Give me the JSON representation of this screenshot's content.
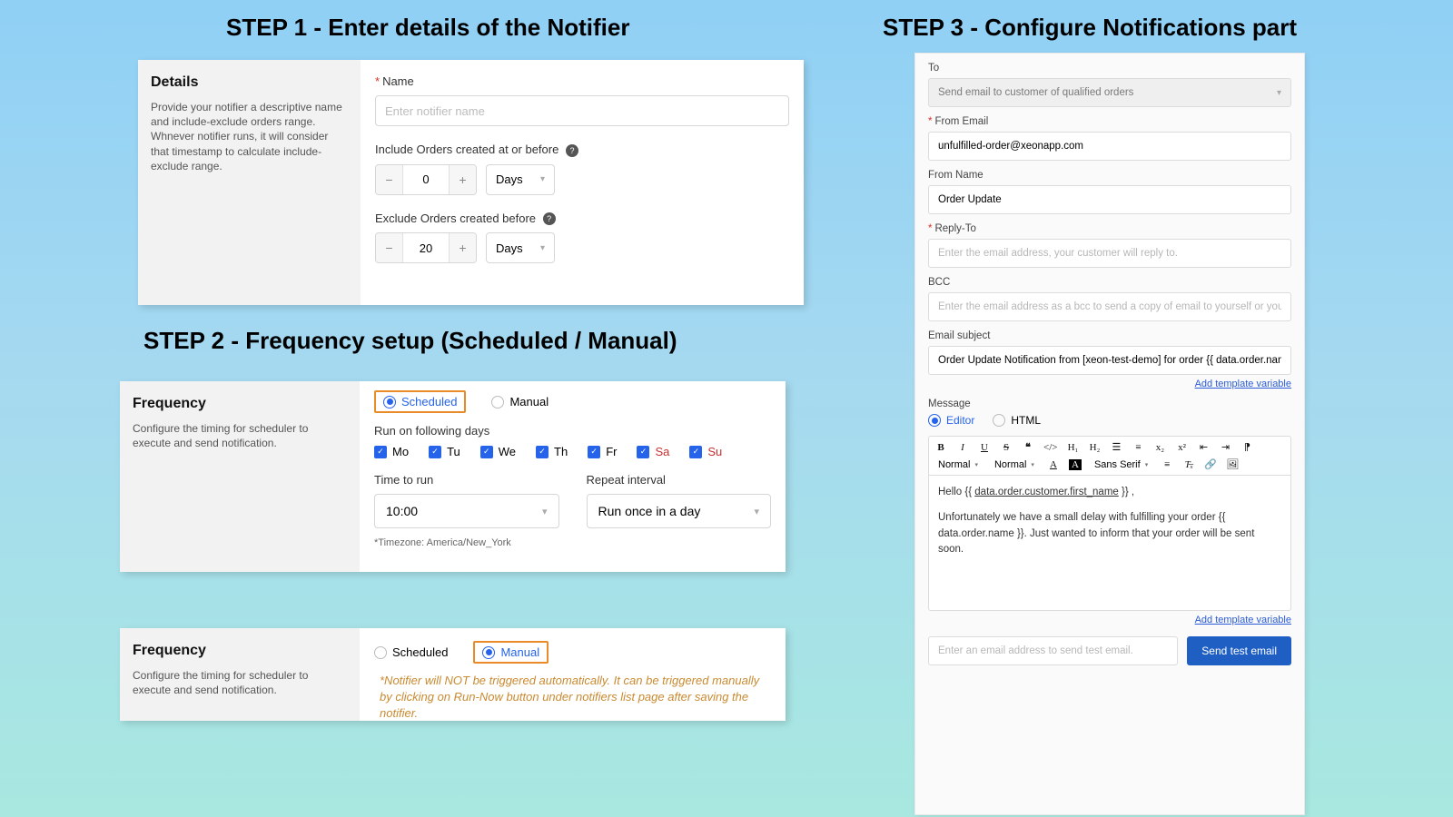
{
  "headings": {
    "step1": "STEP 1 - Enter details of the Notifier",
    "step2": "STEP 2 - Frequency setup (Scheduled / Manual)",
    "step3": "STEP 3  - Configure Notifications part"
  },
  "step1": {
    "left_title": "Details",
    "left_desc": "Provide your notifier a descriptive name and include-exclude orders range. Whnever notifier runs, it will consider that timestamp to calculate include-exclude range.",
    "name_label": "Name",
    "name_placeholder": "Enter notifier name",
    "include_label": "Include Orders created at or before",
    "include_value": "0",
    "include_unit": "Days",
    "exclude_label": "Exclude Orders created before",
    "exclude_value": "20",
    "exclude_unit": "Days"
  },
  "step2a": {
    "left_title": "Frequency",
    "left_desc": "Configure the timing for scheduler to execute and send notification.",
    "opt_scheduled": "Scheduled",
    "opt_manual": "Manual",
    "days_label": "Run on following days",
    "days": [
      "Mo",
      "Tu",
      "We",
      "Th",
      "Fr",
      "Sa",
      "Su"
    ],
    "time_label": "Time to run",
    "time_value": "10:00",
    "repeat_label": "Repeat interval",
    "repeat_value": "Run once in a day",
    "tz": "*Timezone: America/New_York"
  },
  "step2b": {
    "left_title": "Frequency",
    "left_desc": "Configure the timing for scheduler to execute and send notification.",
    "opt_scheduled": "Scheduled",
    "opt_manual": "Manual",
    "note": "*Notifier will NOT be triggered automatically. It can be triggered manually by clicking on Run-Now button under notifiers list page after saving the notifier."
  },
  "step3": {
    "to_label": "To",
    "to_value": "Send email to customer of qualified orders",
    "from_email_label": "From Email",
    "from_email_value": "unfulfilled-order@xeonapp.com",
    "from_name_label": "From Name",
    "from_name_value": "Order Update",
    "reply_label": "Reply-To",
    "reply_placeholder": "Enter the email address, your customer will reply to.",
    "bcc_label": "BCC",
    "bcc_placeholder": "Enter the email address as a bcc to send a copy of email to yourself or your team",
    "subject_label": "Email subject",
    "subject_value": "Order Update Notification from [xeon-test-demo] for order {{ data.order.name }}",
    "add_var": "Add template variable",
    "message_label": "Message",
    "opt_editor": "Editor",
    "opt_html": "HTML",
    "toolbar": {
      "normal": "Normal",
      "sans": "Sans Serif"
    },
    "body_hello_pre": "Hello {{ ",
    "body_hello_var": "data.order.customer.first_name",
    "body_hello_post": " }} ,",
    "body_p2": "Unfortunately we have a small delay with fulfilling your order {{ data.order.name }}. Just wanted to inform that your order will be sent soon.",
    "test_placeholder": "Enter an email address to send test email.",
    "send_btn": "Send test email"
  }
}
